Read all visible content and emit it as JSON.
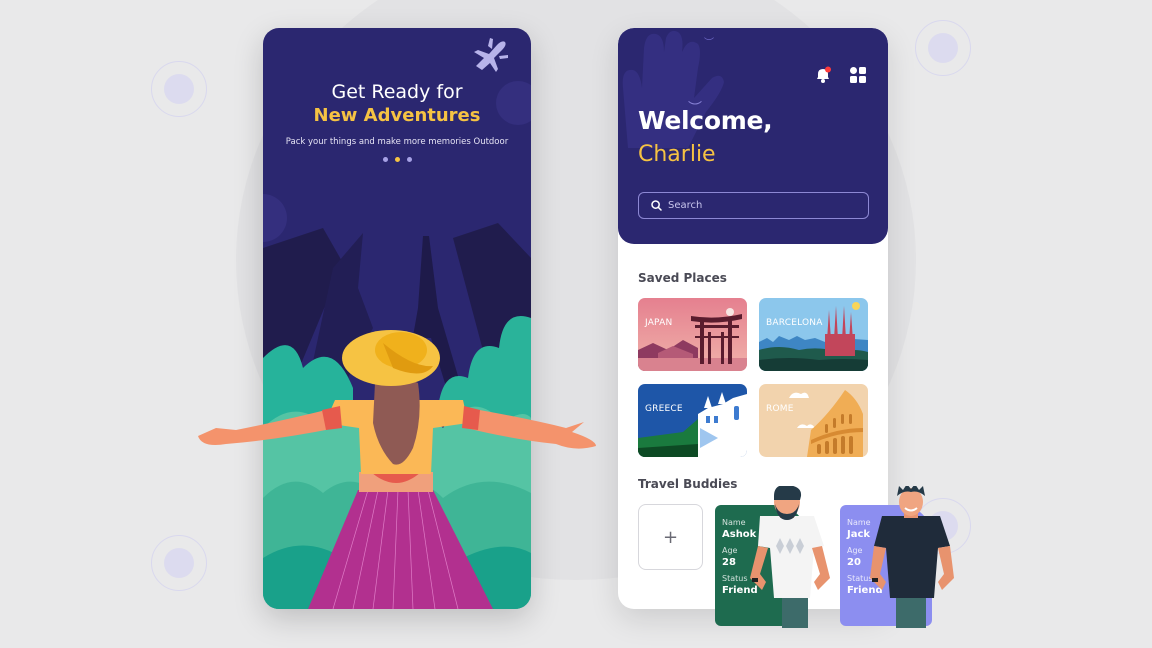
{
  "colors": {
    "brand_navy": "#2b2770",
    "accent_yellow": "#f6c343",
    "buddy_green": "#1e6b4f",
    "buddy_lavender": "#8c8ef0",
    "notification_red": "#ff3b3b"
  },
  "onboarding": {
    "title_line1": "Get Ready for",
    "title_line2": "New Adventures",
    "subtitle": "Pack your things and make more memories Outdoor",
    "pager": {
      "total": 3,
      "active_index": 1
    },
    "icon": "airplane-icon"
  },
  "home": {
    "greeting": "Welcome,",
    "user_name": "Charlie",
    "icons": {
      "notifications": "bell-icon",
      "menu": "grid-menu-icon",
      "search": "search-icon"
    },
    "notification_badge": true,
    "search": {
      "placeholder": "Search",
      "value": ""
    },
    "saved_places": {
      "title": "Saved Places",
      "items": [
        {
          "label": "JAPAN"
        },
        {
          "label": "BARCELONA"
        },
        {
          "label": "GREECE"
        },
        {
          "label": "ROME"
        }
      ]
    },
    "travel_buddies": {
      "title": "Travel Buddies",
      "add_label": "+",
      "items": [
        {
          "name_label": "Name",
          "name": "Ashok",
          "age_label": "Age",
          "age": "28",
          "status_label": "Status",
          "status": "Friend"
        },
        {
          "name_label": "Name",
          "name": "Jack",
          "age_label": "Age",
          "age": "20",
          "status_label": "Status",
          "status": "Friend"
        }
      ]
    }
  }
}
